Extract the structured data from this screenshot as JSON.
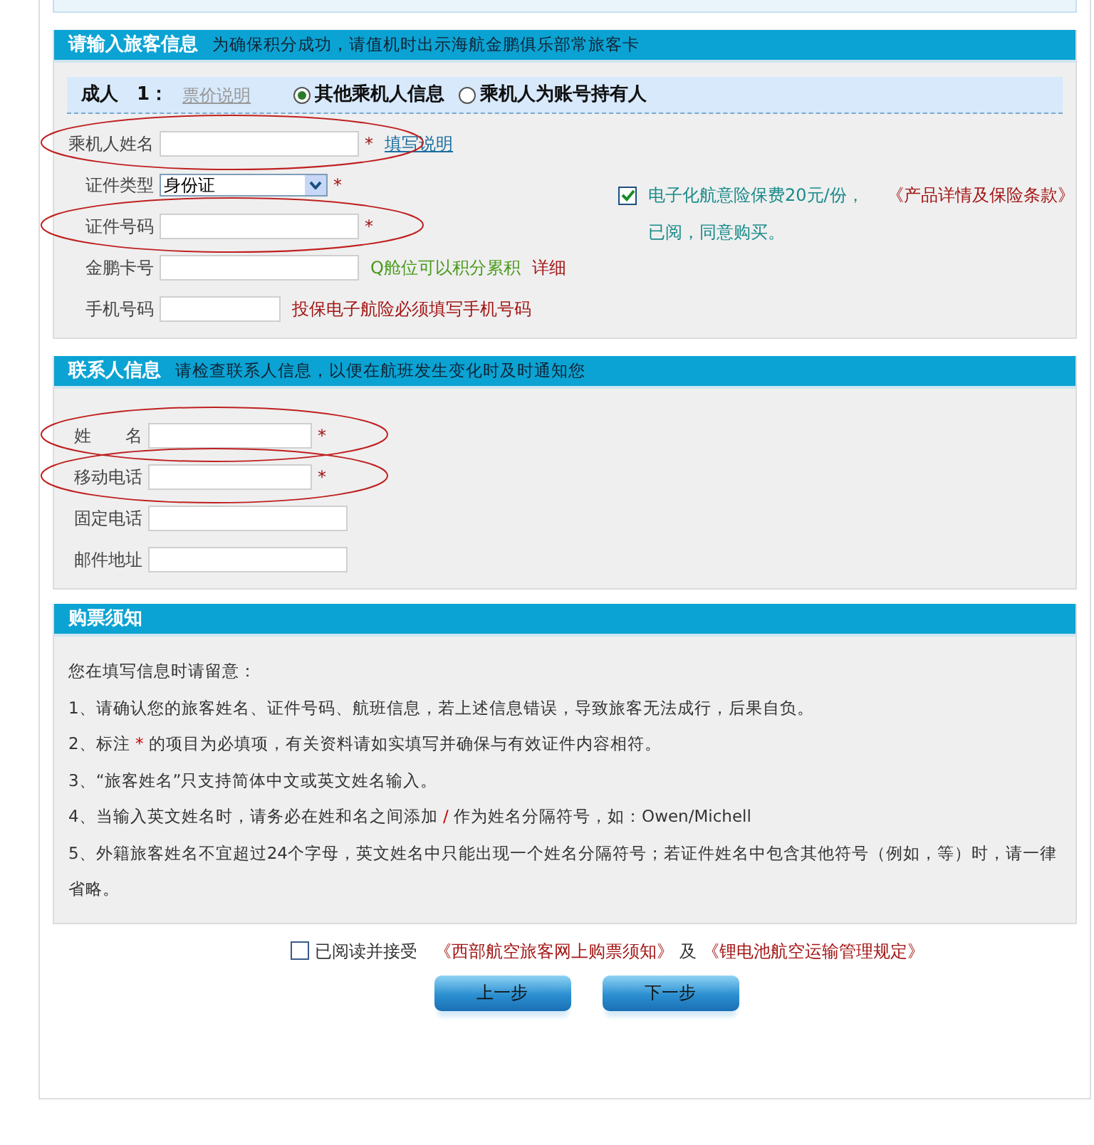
{
  "passenger_section": {
    "title": "请输入旅客信息",
    "subtitle": "为确保积分成功，请值机时出示海航金鹏俱乐部常旅客卡",
    "passenger_label": "成人　1：",
    "fare_link": "票价说明",
    "options": [
      {
        "label": "其他乘机人信息",
        "selected": true
      },
      {
        "label": "乘机人为账号持有人",
        "selected": false
      }
    ],
    "fields": [
      {
        "kind": "input",
        "label": "乘机人姓名",
        "required": true,
        "annotated": true,
        "link": "填写说明"
      },
      {
        "kind": "select",
        "label": "证件类型",
        "value": "身份证",
        "required": true,
        "annotated": false
      },
      {
        "kind": "input",
        "label": "证件号码",
        "required": true,
        "annotated": true
      },
      {
        "kind": "input",
        "label": "金鹏卡号",
        "required": false,
        "annotated": false,
        "notes": [
          {
            "text": "Q舱位可以积分累积",
            "color": "#4a9a1a"
          },
          {
            "text": "详细",
            "color": "#a31515"
          }
        ]
      },
      {
        "kind": "input",
        "label": "手机号码",
        "required": false,
        "annotated": false,
        "notes": [
          {
            "text": "投保电子航险必须填写手机号码",
            "color": "#a31515"
          }
        ]
      }
    ],
    "insurance": {
      "checked": true,
      "text": "电子化航意险保费20元/份，",
      "link": "《产品详情及保险条款》",
      "text2": "已阅，同意购买。"
    }
  },
  "contact_section": {
    "title": "联系人信息",
    "subtitle": "请检查联系人信息，以便在航班发生变化时及时通知您",
    "fields": [
      {
        "kind": "input",
        "label": "姓　　名",
        "required": true,
        "annotated": true
      },
      {
        "kind": "input",
        "label": "移动电话",
        "required": true,
        "annotated": true
      },
      {
        "kind": "input",
        "label": "固定电话",
        "required": false,
        "annotated": false
      },
      {
        "kind": "input",
        "label": "邮件地址",
        "required": false,
        "annotated": false
      }
    ]
  },
  "notice": {
    "title": "购票须知",
    "intro": "您在填写信息时请留意：",
    "items": [
      [
        {
          "text": "1、请确认您的旅客姓名、证件号码、航班信息，若上述信息错误，导致旅客无法成行，后果自负。",
          "accent": false
        }
      ],
      [
        {
          "text": "2、标注 ",
          "accent": false
        },
        {
          "text": "*",
          "accent": true
        },
        {
          "text": " 的项目为必填项，有关资料请如实填写并确保与有效证件内容相符。",
          "accent": false
        }
      ],
      [
        {
          "text": "3、“旅客姓名”只支持简体中文或英文姓名输入。",
          "accent": false
        }
      ],
      [
        {
          "text": "4、当输入英文姓名时，请务必在姓和名之间添加 ",
          "accent": false
        },
        {
          "text": "/",
          "accent": true
        },
        {
          "text": " 作为姓名分隔符号，如：Owen/Michell",
          "accent": false
        }
      ],
      [
        {
          "text": "5、外籍旅客姓名不宜超过24个字母，英文姓名中只能出现一个姓名分隔符号；若证件姓名中包含其他符号（例如，等）时，请一律省略。",
          "accent": false
        }
      ]
    ]
  },
  "agreement": {
    "checked": false,
    "text": "已阅读并接受",
    "link1": "《西部航空旅客网上购票须知》",
    "conjunction": "及",
    "link2": "《锂电池航空运输管理规定》"
  },
  "buttons": [
    "上一步",
    "下一步"
  ]
}
